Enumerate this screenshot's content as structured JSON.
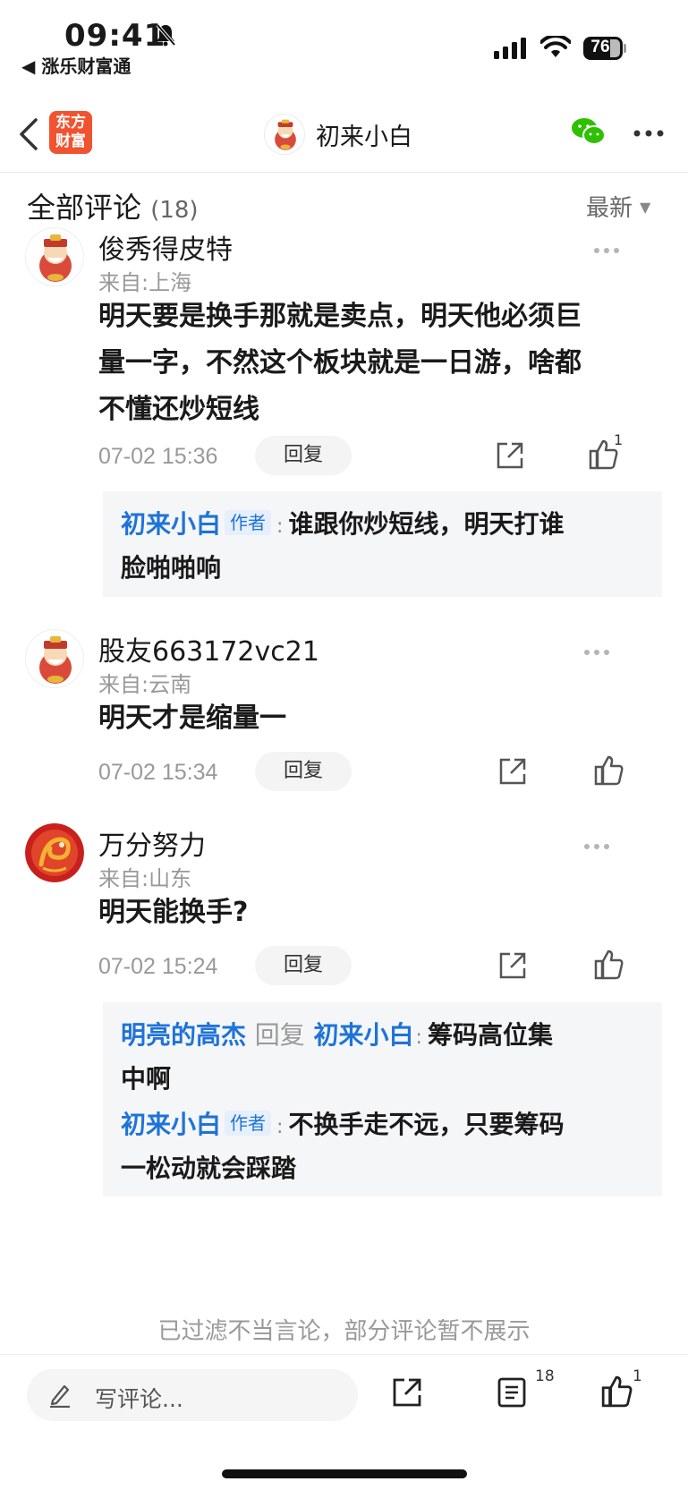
{
  "status_bar": {
    "time": "09:41",
    "back_app": "◀ 涨乐财富通",
    "battery": "76"
  },
  "nav": {
    "logo_line1": "东方",
    "logo_line2": "财富",
    "title": "初来小白"
  },
  "header": {
    "title": "全部评论",
    "count": "(18)",
    "sort": "最新"
  },
  "comments": [
    {
      "name": "俊秀得皮特",
      "location": "来自:上海",
      "text_lines": [
        "明天要是换手那就是卖点，明天他必须巨",
        "量一字，不然这个板块就是一日游，啥都",
        "不懂还炒短线"
      ],
      "date": "07-02 15:36",
      "reply_label": "回复",
      "likes": "1",
      "replies": [
        {
          "author": "初来小白",
          "tag": "作者",
          "lines": [
            "谁跟你炒短线，明天打谁",
            "脸啪啪响"
          ]
        }
      ]
    },
    {
      "name": "股友663172vc21",
      "location": "来自:云南",
      "text_lines": [
        "明天才是缩量一"
      ],
      "date": "07-02 15:34",
      "reply_label": "回复",
      "likes": ""
    },
    {
      "name": "万分努力",
      "location": "来自:山东",
      "text_lines": [
        "明天能换手?"
      ],
      "date": "07-02 15:24",
      "reply_label": "回复",
      "likes": "",
      "replies": [
        {
          "author": "明亮的高杰",
          "reply_word": "回复",
          "target": "初来小白",
          "lines": [
            "筹码高位集",
            "中啊"
          ]
        },
        {
          "author": "初来小白",
          "tag": "作者",
          "lines": [
            "不换手走不远，只要筹码",
            "一松动就会踩踏"
          ]
        }
      ]
    }
  ],
  "filtered_notice": "已过滤不当言论，部分评论暂不展示",
  "bottom_bar": {
    "placeholder": "写评论...",
    "comment_count": "18",
    "like_count": "1"
  },
  "colors": {
    "accent_blue": "#1e73d8",
    "logo_orange": "#f0532f",
    "wechat_green": "#2dc100"
  }
}
